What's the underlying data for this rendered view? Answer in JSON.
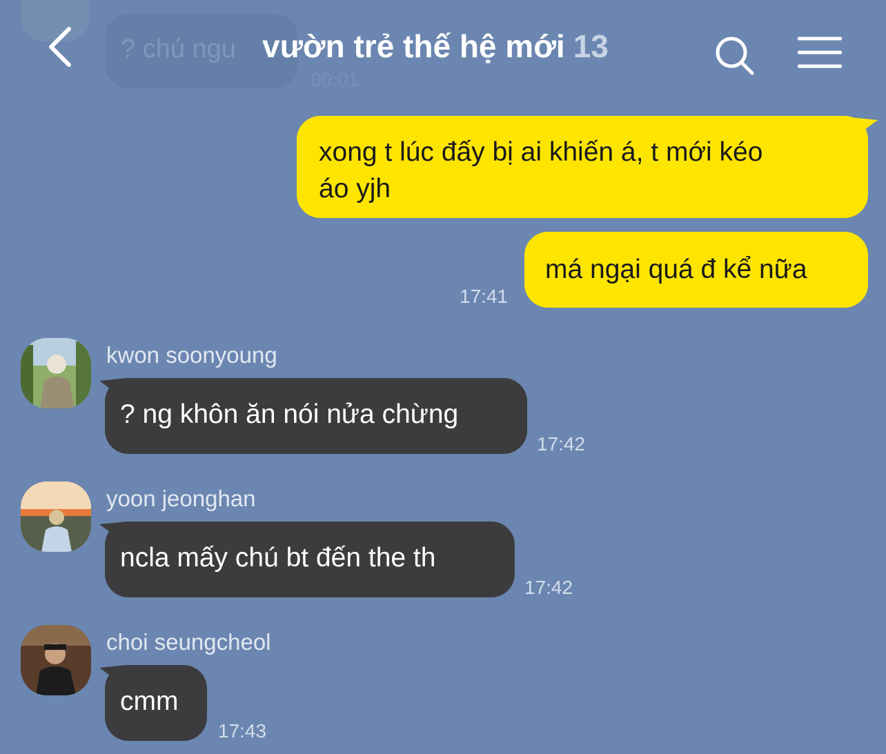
{
  "header": {
    "title": "vườn trẻ thế hệ mới",
    "member_count": "13"
  },
  "previous": {
    "text": "? chú ngu",
    "time": "00:01"
  },
  "messages": [
    {
      "text": "xong t lúc đấy bị ai khiến á, t mới kéo áo yjh",
      "line1": "xong t lúc đấy bị ai khiến á, t mới kéo",
      "line2": "áo yjh"
    },
    {
      "text": "má ngại quá đ kể nữa",
      "time": "17:41"
    },
    {
      "sender": "kwon soonyoung",
      "text": "? ng khôn ăn nói nửa chừng",
      "time": "17:42"
    },
    {
      "sender": "yoon jeonghan",
      "text": "ncla mấy chú bt đến the th",
      "time": "17:42"
    },
    {
      "sender": "choi seungcheol",
      "text": "cmm",
      "time": "17:43"
    }
  ],
  "colors": {
    "background": "#6b86b0",
    "my_bubble": "#fee500",
    "other_bubble": "#3c3c3e"
  },
  "icons": [
    "back-arrow-icon",
    "search-icon",
    "menu-icon"
  ]
}
